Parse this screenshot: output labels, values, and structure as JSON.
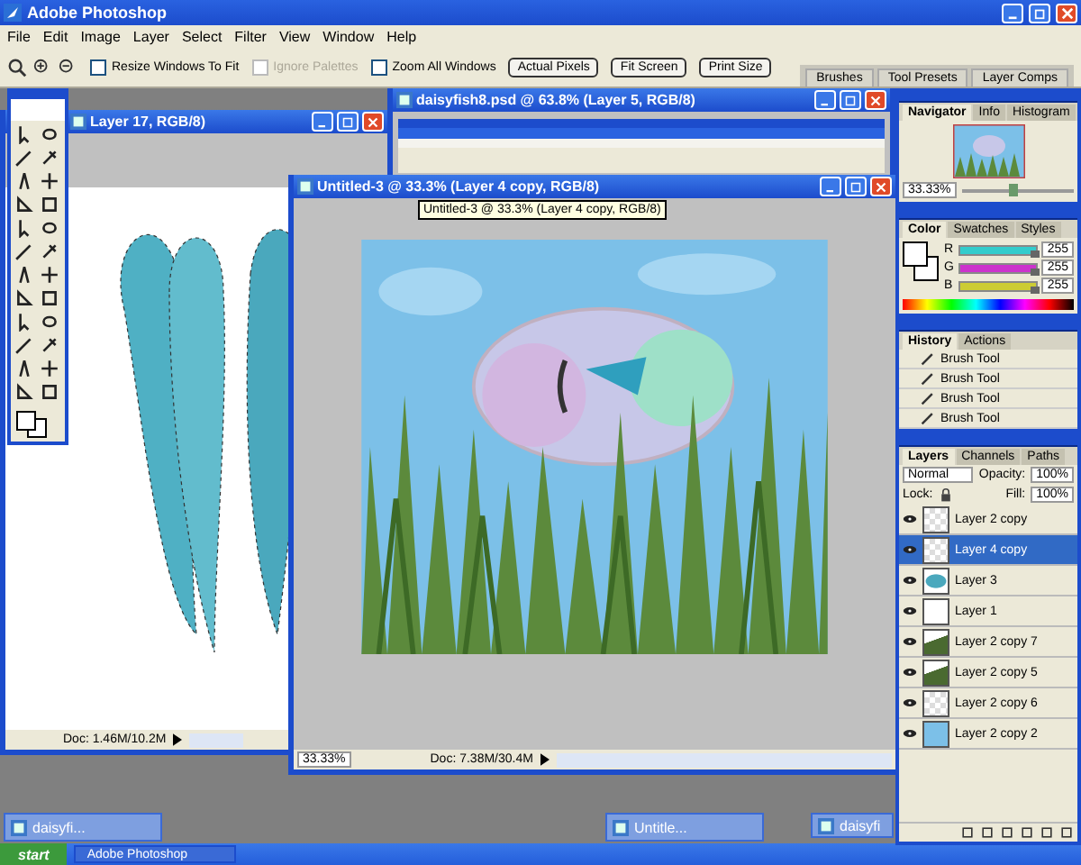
{
  "window": {
    "title": "Adobe Photoshop"
  },
  "menu": [
    "File",
    "Edit",
    "Image",
    "Layer",
    "Select",
    "Filter",
    "View",
    "Window",
    "Help"
  ],
  "options_bar": {
    "checkboxes": [
      {
        "label": "Resize Windows To Fit",
        "checked": false,
        "disabled": false
      },
      {
        "label": "Ignore Palettes",
        "checked": false,
        "disabled": true
      },
      {
        "label": "Zoom All Windows",
        "checked": false,
        "disabled": false
      }
    ],
    "buttons": [
      "Actual Pixels",
      "Fit Screen",
      "Print Size"
    ],
    "palette_well_tabs": [
      "Brushes",
      "Tool Presets",
      "Layer Comps"
    ]
  },
  "documents": [
    {
      "kind": "cutout",
      "title": "Layer 17, RGB/8)",
      "status": "Doc: 1.46M/10.2M"
    },
    {
      "kind": "screenshot",
      "title": "daisyfish8.psd @ 63.8% (Layer 5, RGB/8)"
    },
    {
      "kind": "painting",
      "title": "Untitled-3 @ 33.3% (Layer 4 copy, RGB/8)",
      "zoom": "33.33%",
      "status": "Doc: 7.38M/30.4M"
    }
  ],
  "tooltip": "Untitled-3 @ 33.3% (Layer 4 copy, RGB/8)",
  "navigator": {
    "tabs": [
      {
        "label": "Navigator",
        "selected": true
      },
      {
        "label": "Info",
        "selected": false
      },
      {
        "label": "Histogram",
        "selected": false
      }
    ],
    "zoom": "33.33%",
    "level": 0.45
  },
  "color": {
    "tabs": [
      {
        "label": "Color",
        "selected": true
      },
      {
        "label": "Swatches",
        "selected": false
      },
      {
        "label": "Styles",
        "selected": false
      }
    ],
    "channels": [
      {
        "name": "R",
        "value": "255",
        "level": 1,
        "color": "#33cccc"
      },
      {
        "name": "G",
        "value": "255",
        "level": 1,
        "color": "#cc33cc"
      },
      {
        "name": "B",
        "value": "255",
        "level": 1,
        "color": "#cccc33"
      }
    ]
  },
  "history": {
    "tabs": [
      {
        "label": "History",
        "selected": true
      },
      {
        "label": "Actions",
        "selected": false
      }
    ],
    "items": [
      "Brush Tool",
      "Brush Tool",
      "Brush Tool",
      "Brush Tool"
    ]
  },
  "layers": {
    "tabs": [
      {
        "label": "Layers",
        "selected": true
      },
      {
        "label": "Channels",
        "selected": false
      },
      {
        "label": "Paths",
        "selected": false
      }
    ],
    "blend_mode": "Normal",
    "opacity_label": "Opacity:",
    "opacity": "100%",
    "lock_label": "Lock:",
    "fill_label": "Fill:",
    "fill": "100%",
    "items": [
      {
        "name": "Layer 2 copy",
        "kind": "transparent",
        "selected": false
      },
      {
        "name": "Layer 4 copy",
        "kind": "transparent",
        "selected": true
      },
      {
        "name": "Layer 3",
        "kind": "fish",
        "selected": false
      },
      {
        "name": "Layer 1",
        "kind": "white",
        "selected": false
      },
      {
        "name": "Layer 2 copy 7",
        "kind": "grass",
        "selected": false
      },
      {
        "name": "Layer 2 copy 5",
        "kind": "grass",
        "selected": false
      },
      {
        "name": "Layer 2 copy 6",
        "kind": "transparent",
        "selected": false
      },
      {
        "name": "Layer 2 copy 2",
        "kind": "sky",
        "selected": false
      }
    ]
  },
  "minimized": [
    "daisyfi...",
    "Untitle...",
    "daisyfi"
  ],
  "taskbar": {
    "start": "start",
    "items": [
      "Adobe Photoshop"
    ]
  }
}
